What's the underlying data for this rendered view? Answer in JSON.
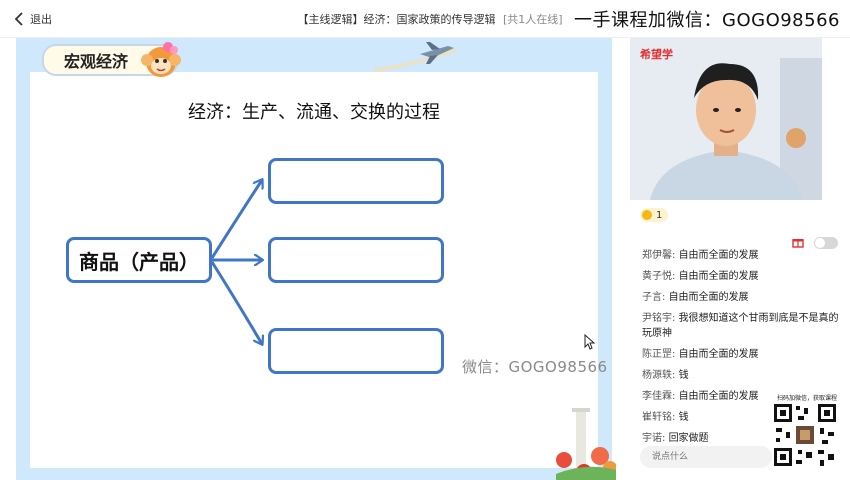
{
  "topbar": {
    "exit_label": "退出",
    "class_title": "【主线逻辑】经济：国家政策的传导逻辑",
    "online_count": "[共1人在线]",
    "watermark": "一手课程加微信：GOGO98566"
  },
  "slide": {
    "section_tab": "宏观经济",
    "heading": "经济：生产、流通、交换的过程",
    "center_box": "商品（产品）",
    "watermark": "微信：GOGO98566"
  },
  "video": {
    "brand": "希望学"
  },
  "stats": {
    "count": "1"
  },
  "chat": {
    "messages": [
      {
        "name": "郑伊馨:",
        "text": "自由而全面的发展"
      },
      {
        "name": "黄子悦:",
        "text": "自由而全面的发展"
      },
      {
        "name": "子言:",
        "text": "自由而全面的发展"
      },
      {
        "name": "尹铭宇:",
        "text": "我很想知道这个甘雨到底是不是真的玩原神"
      },
      {
        "name": "陈正罡:",
        "text": "自由而全面的发展"
      },
      {
        "name": "杨源轶:",
        "text": "钱"
      },
      {
        "name": "李佳霖:",
        "text": "自由而全面的发展"
      },
      {
        "name": "崔轩铭:",
        "text": "钱"
      },
      {
        "name": "宇诺:",
        "text": "回家做题"
      }
    ],
    "input_placeholder": "说点什么",
    "qr_caption": "扫码加微信，获取课程"
  },
  "colors": {
    "slide_background": "#cfe8fb",
    "diagram_blue": "#3f77c6",
    "brand_red": "#e03131",
    "coin_gold": "#f5b914"
  }
}
